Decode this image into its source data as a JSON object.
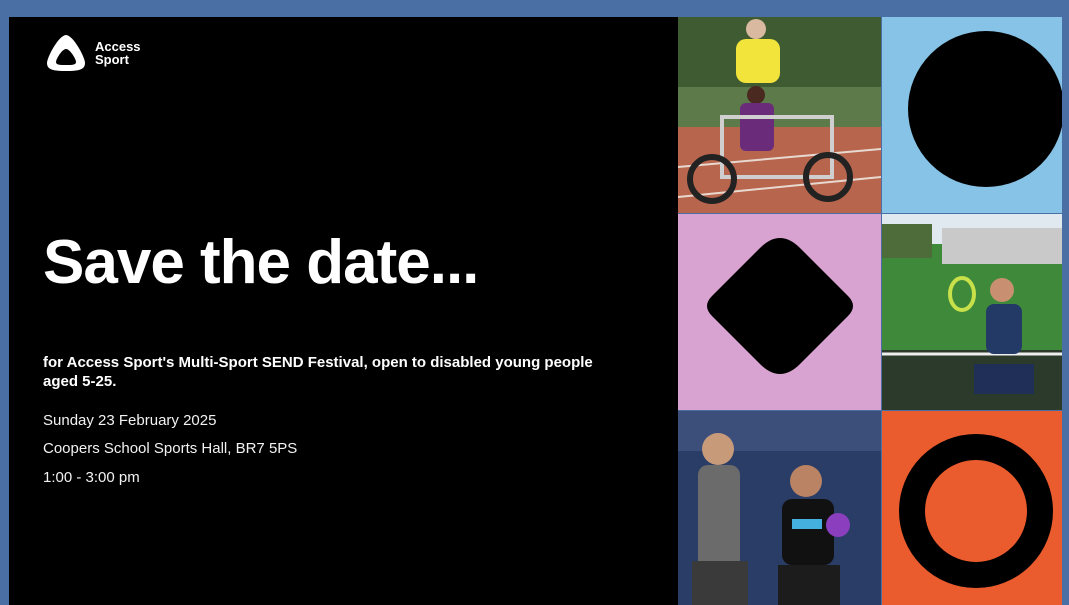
{
  "brand": {
    "line1": "Access",
    "line2": "Sport"
  },
  "headline": "Save the date...",
  "intro": "for Access Sport's Multi-Sport SEND Festival, open to disabled young people aged 5-25.",
  "details": {
    "date": "Sunday 23 February 2025",
    "venue": "Coopers School Sports Hall, BR7 5PS",
    "time": "1:00 - 3:00 pm"
  },
  "colors": {
    "background": "#000000",
    "text": "#ffffff",
    "sky_blue": "#86c3e6",
    "pink": "#d8a3d0",
    "orange": "#ea5b2d",
    "frame": "#4a6fa5"
  },
  "tiles": [
    {
      "kind": "photo",
      "subject": "adaptive-tandem-cycle-photo"
    },
    {
      "kind": "shape",
      "shape": "circle-icon"
    },
    {
      "kind": "shape",
      "shape": "rounded-diamond-icon"
    },
    {
      "kind": "photo",
      "subject": "wheelchair-tennis-photo"
    },
    {
      "kind": "photo",
      "subject": "coaching-session-photo"
    },
    {
      "kind": "shape",
      "shape": "ring-icon"
    }
  ]
}
